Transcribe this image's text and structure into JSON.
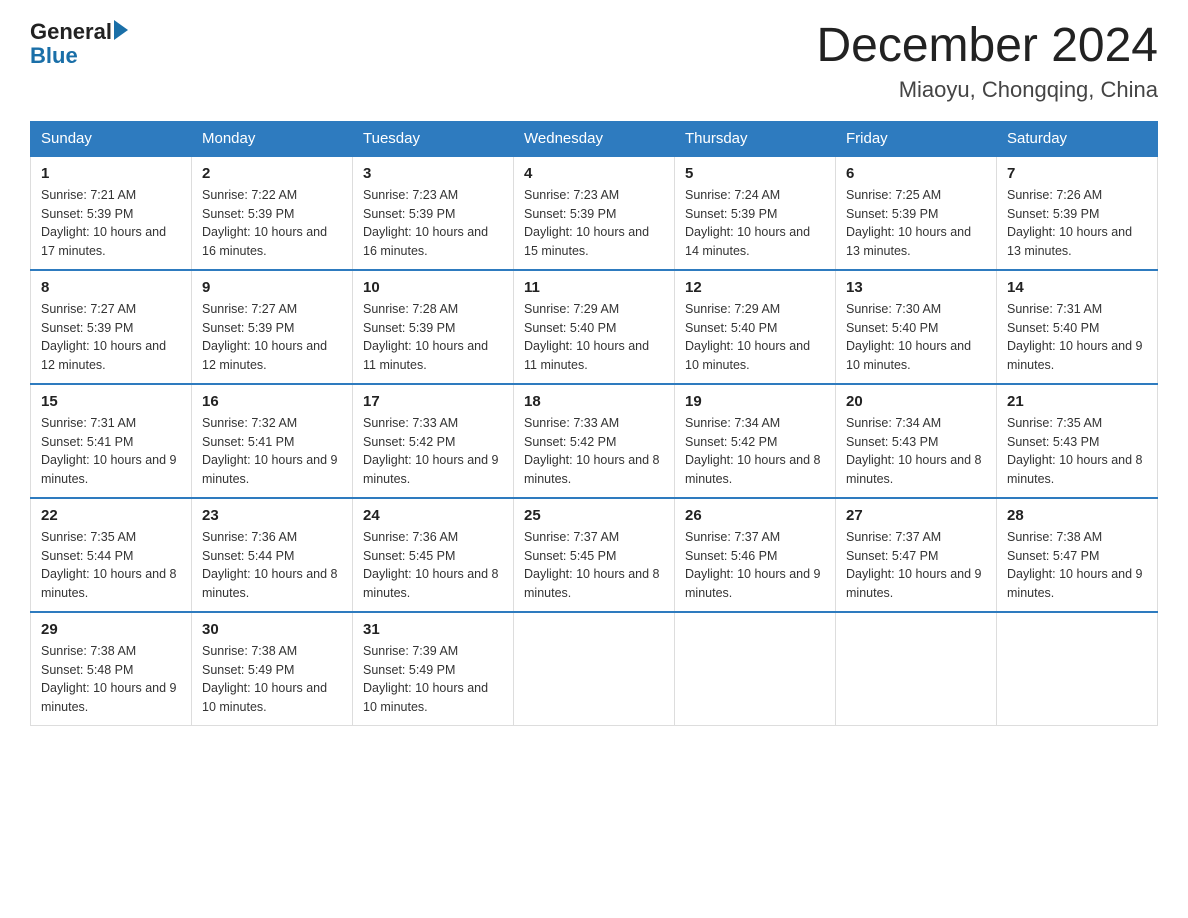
{
  "logo": {
    "general": "General",
    "blue": "Blue",
    "triangle": "▶"
  },
  "title": "December 2024",
  "subtitle": "Miaoyu, Chongqing, China",
  "days_of_week": [
    "Sunday",
    "Monday",
    "Tuesday",
    "Wednesday",
    "Thursday",
    "Friday",
    "Saturday"
  ],
  "weeks": [
    [
      {
        "day": "1",
        "sunrise": "7:21 AM",
        "sunset": "5:39 PM",
        "daylight": "10 hours and 17 minutes."
      },
      {
        "day": "2",
        "sunrise": "7:22 AM",
        "sunset": "5:39 PM",
        "daylight": "10 hours and 16 minutes."
      },
      {
        "day": "3",
        "sunrise": "7:23 AM",
        "sunset": "5:39 PM",
        "daylight": "10 hours and 16 minutes."
      },
      {
        "day": "4",
        "sunrise": "7:23 AM",
        "sunset": "5:39 PM",
        "daylight": "10 hours and 15 minutes."
      },
      {
        "day": "5",
        "sunrise": "7:24 AM",
        "sunset": "5:39 PM",
        "daylight": "10 hours and 14 minutes."
      },
      {
        "day": "6",
        "sunrise": "7:25 AM",
        "sunset": "5:39 PM",
        "daylight": "10 hours and 13 minutes."
      },
      {
        "day": "7",
        "sunrise": "7:26 AM",
        "sunset": "5:39 PM",
        "daylight": "10 hours and 13 minutes."
      }
    ],
    [
      {
        "day": "8",
        "sunrise": "7:27 AM",
        "sunset": "5:39 PM",
        "daylight": "10 hours and 12 minutes."
      },
      {
        "day": "9",
        "sunrise": "7:27 AM",
        "sunset": "5:39 PM",
        "daylight": "10 hours and 12 minutes."
      },
      {
        "day": "10",
        "sunrise": "7:28 AM",
        "sunset": "5:39 PM",
        "daylight": "10 hours and 11 minutes."
      },
      {
        "day": "11",
        "sunrise": "7:29 AM",
        "sunset": "5:40 PM",
        "daylight": "10 hours and 11 minutes."
      },
      {
        "day": "12",
        "sunrise": "7:29 AM",
        "sunset": "5:40 PM",
        "daylight": "10 hours and 10 minutes."
      },
      {
        "day": "13",
        "sunrise": "7:30 AM",
        "sunset": "5:40 PM",
        "daylight": "10 hours and 10 minutes."
      },
      {
        "day": "14",
        "sunrise": "7:31 AM",
        "sunset": "5:40 PM",
        "daylight": "10 hours and 9 minutes."
      }
    ],
    [
      {
        "day": "15",
        "sunrise": "7:31 AM",
        "sunset": "5:41 PM",
        "daylight": "10 hours and 9 minutes."
      },
      {
        "day": "16",
        "sunrise": "7:32 AM",
        "sunset": "5:41 PM",
        "daylight": "10 hours and 9 minutes."
      },
      {
        "day": "17",
        "sunrise": "7:33 AM",
        "sunset": "5:42 PM",
        "daylight": "10 hours and 9 minutes."
      },
      {
        "day": "18",
        "sunrise": "7:33 AM",
        "sunset": "5:42 PM",
        "daylight": "10 hours and 8 minutes."
      },
      {
        "day": "19",
        "sunrise": "7:34 AM",
        "sunset": "5:42 PM",
        "daylight": "10 hours and 8 minutes."
      },
      {
        "day": "20",
        "sunrise": "7:34 AM",
        "sunset": "5:43 PM",
        "daylight": "10 hours and 8 minutes."
      },
      {
        "day": "21",
        "sunrise": "7:35 AM",
        "sunset": "5:43 PM",
        "daylight": "10 hours and 8 minutes."
      }
    ],
    [
      {
        "day": "22",
        "sunrise": "7:35 AM",
        "sunset": "5:44 PM",
        "daylight": "10 hours and 8 minutes."
      },
      {
        "day": "23",
        "sunrise": "7:36 AM",
        "sunset": "5:44 PM",
        "daylight": "10 hours and 8 minutes."
      },
      {
        "day": "24",
        "sunrise": "7:36 AM",
        "sunset": "5:45 PM",
        "daylight": "10 hours and 8 minutes."
      },
      {
        "day": "25",
        "sunrise": "7:37 AM",
        "sunset": "5:45 PM",
        "daylight": "10 hours and 8 minutes."
      },
      {
        "day": "26",
        "sunrise": "7:37 AM",
        "sunset": "5:46 PM",
        "daylight": "10 hours and 9 minutes."
      },
      {
        "day": "27",
        "sunrise": "7:37 AM",
        "sunset": "5:47 PM",
        "daylight": "10 hours and 9 minutes."
      },
      {
        "day": "28",
        "sunrise": "7:38 AM",
        "sunset": "5:47 PM",
        "daylight": "10 hours and 9 minutes."
      }
    ],
    [
      {
        "day": "29",
        "sunrise": "7:38 AM",
        "sunset": "5:48 PM",
        "daylight": "10 hours and 9 minutes."
      },
      {
        "day": "30",
        "sunrise": "7:38 AM",
        "sunset": "5:49 PM",
        "daylight": "10 hours and 10 minutes."
      },
      {
        "day": "31",
        "sunrise": "7:39 AM",
        "sunset": "5:49 PM",
        "daylight": "10 hours and 10 minutes."
      },
      null,
      null,
      null,
      null
    ]
  ]
}
